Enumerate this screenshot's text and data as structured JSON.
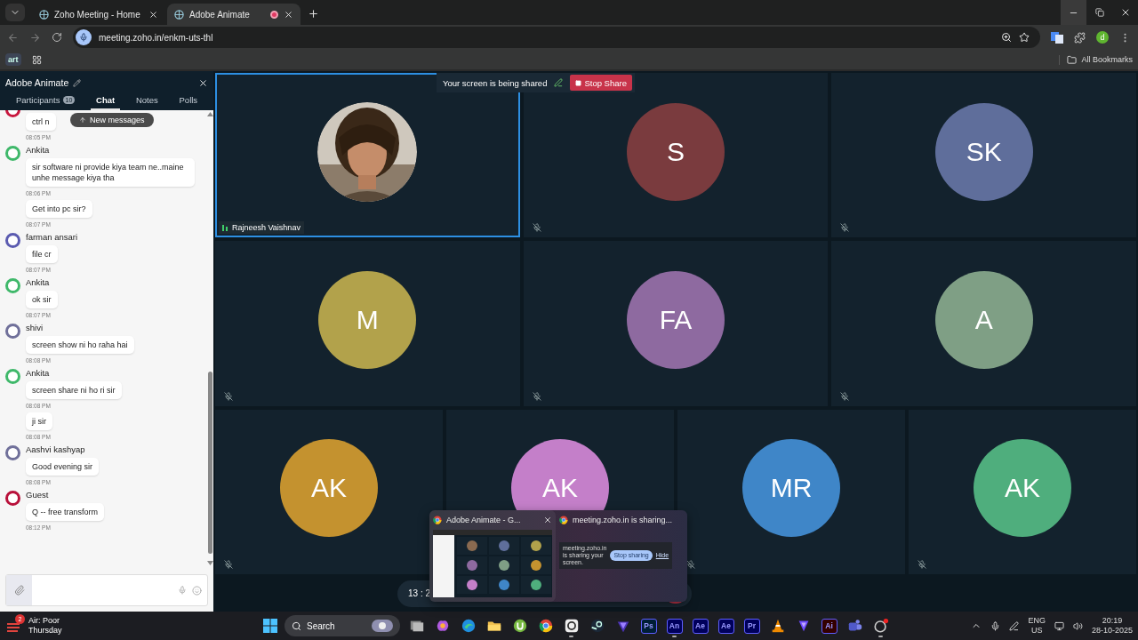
{
  "browser": {
    "tabs": [
      {
        "title": "Zoho Meeting - Home",
        "selected": false,
        "recording": false
      },
      {
        "title": "Adobe Animate",
        "selected": true,
        "recording": true
      }
    ],
    "url": "meeting.zoho.in/enkm-uts-thl",
    "profile_initial": "d",
    "bookmark": "art",
    "all_bookmarks": "All Bookmarks"
  },
  "meeting": {
    "title": "Adobe Animate",
    "tabs": [
      {
        "label": "Participants",
        "badge": "10",
        "selected": false
      },
      {
        "label": "Chat",
        "selected": true
      },
      {
        "label": "Notes",
        "selected": false
      },
      {
        "label": "Polls",
        "selected": false
      }
    ],
    "new_messages": "New messages",
    "messages": [
      {
        "color": "#c8173e",
        "text": "ctrl n",
        "time": "08:05 PM"
      },
      {
        "sender": "Ankita",
        "color": "#3fb86a",
        "text": "sir software ni provide kiya team ne..maine unhe message kiya tha",
        "time": "08:06 PM"
      },
      {
        "text": "Get into pc sir?",
        "time": "08:07 PM"
      },
      {
        "sender": "farman ansari",
        "color": "#5b5bb0",
        "text": "file cr",
        "time": "08:07 PM"
      },
      {
        "sender": "Ankita",
        "color": "#3fb86a",
        "text": "ok sir",
        "time": "08:07 PM"
      },
      {
        "sender": "shivi",
        "color": "#70709a",
        "text": "screen show ni ho raha hai",
        "time": "08:08 PM"
      },
      {
        "sender": "Ankita",
        "color": "#3fb86a",
        "text": "screen share ni ho ri sir",
        "time": "08:08 PM"
      },
      {
        "text": "ji sir",
        "time": "08:08 PM"
      },
      {
        "sender": "Aashvi kashyap",
        "color": "#70709a",
        "text": "Good evening sir",
        "time": "08:08 PM"
      },
      {
        "sender": "Guest",
        "color": "#b8103a",
        "text": "Q -- free transform",
        "time": "08:12 PM"
      }
    ],
    "share_banner": {
      "text": "Your screen is being shared",
      "button": "Stop Share"
    },
    "tile_rows": [
      [
        {
          "kind": "video",
          "name": "Rajneesh Vaishnav",
          "selected": true,
          "muted": false,
          "speaking": true
        },
        {
          "kind": "avatar",
          "initials": "S",
          "color": "#7a3b3e",
          "selected": false,
          "muted": true
        },
        {
          "kind": "avatar",
          "initials": "SK",
          "color": "#5f6e9b",
          "selected": false,
          "muted": true
        }
      ],
      [
        {
          "kind": "avatar",
          "initials": "M",
          "color": "#b2a24b",
          "selected": false,
          "muted": true
        },
        {
          "kind": "avatar",
          "initials": "FA",
          "color": "#8e6aa0",
          "selected": false,
          "muted": true
        },
        {
          "kind": "avatar",
          "initials": "A",
          "color": "#7f9f85",
          "selected": false,
          "muted": true
        }
      ],
      [
        {
          "kind": "avatar",
          "initials": "AK",
          "color": "#c4922f",
          "selected": false,
          "muted": true
        },
        {
          "kind": "avatar",
          "initials": "AK",
          "color": "#c47fc9",
          "selected": false
        },
        {
          "kind": "avatar",
          "initials": "MR",
          "color": "#3f86c8",
          "selected": false,
          "muted": true
        },
        {
          "kind": "avatar",
          "initials": "AK",
          "color": "#4fae7d",
          "selected": false,
          "muted": true
        }
      ]
    ],
    "timer": "13 : 2"
  },
  "preview_popup": {
    "windows": [
      {
        "kind": "meeting",
        "title": "Adobe Animate - G..."
      },
      {
        "kind": "notice",
        "title": "meeting.zoho.in is sharing...",
        "notice": "meeting.zoho.in is sharing your screen.",
        "button": "Stop sharing",
        "link": "Hide"
      }
    ]
  },
  "taskbar": {
    "weather_badge": "2",
    "weather": "Air: Poor",
    "day": "Thursday",
    "search": "Search",
    "pinned": [
      {
        "kind": "icon",
        "running": false
      },
      {
        "kind": "icon",
        "running": false
      },
      {
        "kind": "icon",
        "running": false
      },
      {
        "kind": "icon",
        "running": false
      },
      {
        "kind": "icon",
        "running": false
      },
      {
        "kind": "icon",
        "running": false
      },
      {
        "kind": "icon",
        "running": true
      },
      {
        "kind": "icon",
        "running": false
      },
      {
        "kind": "icon",
        "running": false
      },
      {
        "kind": "app",
        "label": "Ps",
        "color": "#001e36",
        "running": false
      },
      {
        "kind": "app",
        "label": "An",
        "color": "#00005b",
        "running": true
      },
      {
        "kind": "app",
        "label": "Ae",
        "color": "#00005b",
        "running": false
      },
      {
        "kind": "app",
        "label": "Ae",
        "color": "#00005b",
        "running": false
      },
      {
        "kind": "app",
        "label": "Pr",
        "color": "#00005b",
        "running": false
      },
      {
        "kind": "icon",
        "running": false
      },
      {
        "kind": "icon",
        "running": false
      },
      {
        "kind": "app",
        "label": "Ai",
        "color": "#330000",
        "running": false
      },
      {
        "kind": "icon",
        "running": false
      },
      {
        "kind": "icon",
        "running": true
      }
    ],
    "language": "ENG",
    "region": "US",
    "time": "20:19",
    "date": "28-10-2025"
  }
}
